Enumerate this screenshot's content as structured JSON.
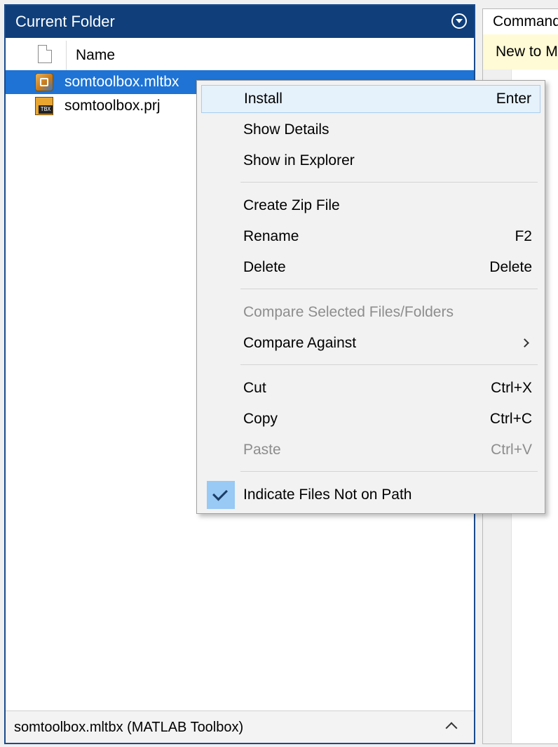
{
  "panel": {
    "title": "Current Folder",
    "column_name": "Name",
    "files": [
      {
        "name": "somtoolbox.mltbx",
        "icon": "mltbx-file-icon",
        "selected": true
      },
      {
        "name": "somtoolbox.prj",
        "icon": "prj-file-icon",
        "selected": false
      }
    ],
    "prj_badge": "TBX",
    "status_text": "somtoolbox.mltbx  (MATLAB Toolbox)"
  },
  "right_panel": {
    "tab_label": "Command Window",
    "notice": "New to MATLAB?"
  },
  "context_menu": {
    "items": [
      {
        "label": "Install",
        "shortcut": "Enter",
        "enabled": true,
        "highlighted": true
      },
      {
        "label": "Show Details",
        "shortcut": "",
        "enabled": true
      },
      {
        "label": "Show in Explorer",
        "shortcut": "",
        "enabled": true
      },
      {
        "label": "Create Zip File",
        "shortcut": "",
        "enabled": true
      },
      {
        "label": "Rename",
        "shortcut": "F2",
        "enabled": true
      },
      {
        "label": "Delete",
        "shortcut": "Delete",
        "enabled": true
      },
      {
        "label": "Compare Selected Files/Folders",
        "shortcut": "",
        "enabled": false
      },
      {
        "label": "Compare Against",
        "shortcut": "",
        "enabled": true,
        "submenu": true
      },
      {
        "label": "Cut",
        "shortcut": "Ctrl+X",
        "enabled": true
      },
      {
        "label": "Copy",
        "shortcut": "Ctrl+C",
        "enabled": true
      },
      {
        "label": "Paste",
        "shortcut": "Ctrl+V",
        "enabled": false
      },
      {
        "label": "Indicate Files Not on Path",
        "shortcut": "",
        "enabled": true,
        "checked": true
      }
    ]
  },
  "colors": {
    "header_bg": "#0f3e7a",
    "selection": "#1e73d4",
    "menu_highlight": "#e5f1fb",
    "check_bg": "#99c9f5"
  }
}
